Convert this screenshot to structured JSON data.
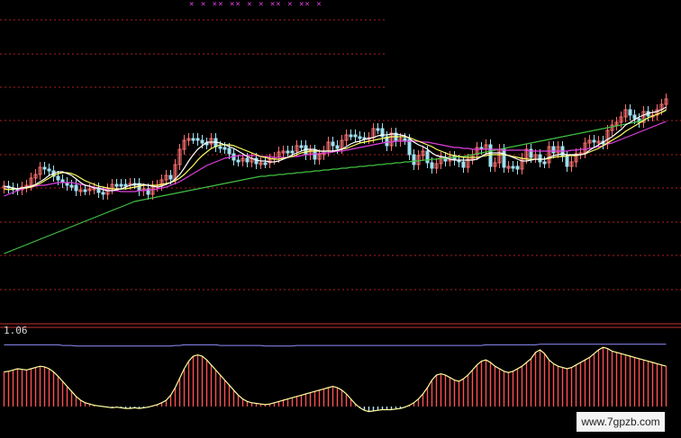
{
  "watermark": "www.7gpzb.com",
  "top_marks": "× ×  ×× ××  × ×  ××  × ××  ×",
  "colors": {
    "background": "#000000",
    "grid": "#b02020",
    "divider": "#c03030",
    "candle_up": "#ff7070",
    "candle_down": "#9fe0f0",
    "ma_short": "#ffffff",
    "ma_mid": "#ffff66",
    "ma_long": "#e040e0",
    "ma_very_long": "#40c040",
    "osc_line": "#ffffa0",
    "osc_bar_pos": "#ff5050",
    "osc_bar_neg": "#b0e0ff",
    "osc_ref_line": "#9090ff"
  },
  "chart_data": [
    {
      "type": "candlestick",
      "panel": "price",
      "grid": true,
      "candles_close": [
        207,
        209,
        210,
        211,
        208,
        206,
        198,
        194,
        186,
        188,
        190,
        196,
        200,
        203,
        206,
        206,
        212,
        211,
        211,
        210,
        209,
        214,
        216,
        210,
        205,
        205,
        205,
        205,
        204,
        204,
        212,
        210,
        216,
        207,
        206,
        200,
        195,
        199,
        183,
        166,
        156,
        154,
        154,
        156,
        159,
        160,
        154,
        163,
        164,
        165,
        171,
        178,
        179,
        176,
        180,
        176,
        182,
        181,
        181,
        177,
        175,
        169,
        168,
        168,
        168,
        162,
        162,
        172,
        167,
        177,
        172,
        168,
        158,
        162,
        165,
        156,
        150,
        150,
        152,
        153,
        154,
        153,
        143,
        143,
        152,
        162,
        148,
        157,
        154,
        155,
        172,
        183,
        173,
        168,
        181,
        187,
        182,
        175,
        179,
        174,
        178,
        180,
        186,
        177,
        172,
        164,
        166,
        161,
        185,
        181,
        166,
        186,
        185,
        185,
        188,
        176,
        166,
        175,
        172,
        180,
        181,
        163,
        170,
        163,
        174,
        185,
        180,
        171,
        170,
        159,
        156,
        158,
        157,
        160,
        145,
        139,
        136,
        130,
        122,
        128,
        132,
        136,
        124,
        129,
        128,
        122,
        116,
        110
      ],
      "ma_short": [
        207,
        208,
        209,
        210,
        209,
        208,
        207,
        205,
        202,
        199,
        195,
        193,
        191,
        191,
        193,
        195,
        199,
        203,
        206,
        207,
        209,
        209,
        211,
        212,
        212,
        211,
        210,
        208,
        206,
        205,
        205,
        205,
        206,
        207,
        208,
        207,
        205,
        203,
        199,
        194,
        187,
        179,
        172,
        166,
        162,
        158,
        158,
        158,
        159,
        161,
        163,
        165,
        168,
        171,
        174,
        176,
        178,
        179,
        179,
        180,
        180,
        179,
        177,
        175,
        172,
        170,
        168,
        166,
        166,
        166,
        168,
        168,
        168,
        168,
        167,
        166,
        163,
        160,
        158,
        157,
        155,
        154,
        153,
        151,
        150,
        150,
        149,
        149,
        150,
        151,
        154,
        158,
        161,
        163,
        166,
        170,
        173,
        174,
        175,
        177,
        178,
        178,
        178,
        178,
        178,
        177,
        174,
        171,
        170,
        170,
        170,
        171,
        173,
        175,
        177,
        179,
        179,
        178,
        177,
        177,
        177,
        175,
        173,
        172,
        171,
        172,
        172,
        172,
        172,
        171,
        167,
        164,
        161,
        158,
        155,
        152,
        148,
        144,
        139,
        136,
        133,
        130,
        128,
        126,
        125,
        124,
        122,
        119
      ],
      "ma_mid": [
        210,
        211,
        210,
        210,
        209,
        209,
        208,
        206,
        204,
        201,
        198,
        195,
        193,
        192,
        192,
        193,
        195,
        198,
        201,
        203,
        205,
        207,
        208,
        209,
        210,
        210,
        210,
        210,
        209,
        208,
        207,
        206,
        206,
        206,
        206,
        205,
        204,
        203,
        201,
        198,
        194,
        189,
        184,
        178,
        173,
        169,
        165,
        163,
        161,
        161,
        161,
        162,
        164,
        166,
        168,
        170,
        172,
        174,
        175,
        176,
        177,
        177,
        176,
        175,
        174,
        172,
        170,
        169,
        168,
        168,
        168,
        168,
        168,
        168,
        167,
        166,
        165,
        163,
        161,
        159,
        158,
        157,
        156,
        155,
        154,
        153,
        152,
        152,
        152,
        152,
        153,
        155,
        157,
        159,
        161,
        163,
        166,
        168,
        170,
        172,
        173,
        174,
        175,
        175,
        175,
        175,
        174,
        173,
        172,
        172,
        172,
        172,
        173,
        174,
        175,
        176,
        177,
        177,
        177,
        177,
        177,
        176,
        175,
        174,
        174,
        173,
        173,
        173,
        172,
        171,
        169,
        167,
        165,
        162,
        159,
        156,
        153,
        150,
        146,
        143,
        140,
        137,
        134,
        131,
        129,
        127,
        125,
        122
      ],
      "ma_long": [
        218,
        216,
        214,
        212,
        210,
        209,
        208,
        207,
        206,
        206,
        205,
        204,
        203,
        203,
        203,
        203,
        204,
        205,
        206,
        207,
        208,
        209,
        210,
        211,
        212,
        212,
        213,
        213,
        213,
        213,
        212,
        212,
        211,
        211,
        210,
        209,
        208,
        206,
        204,
        202,
        199,
        196,
        193,
        190,
        187,
        184,
        182,
        180,
        178,
        176,
        175,
        174,
        173,
        173,
        173,
        173,
        173,
        174,
        174,
        174,
        175,
        175,
        175,
        175,
        174,
        174,
        173,
        172,
        172,
        171,
        171,
        170,
        170,
        169,
        168,
        168,
        167,
        166,
        165,
        164,
        163,
        162,
        161,
        160,
        159,
        158,
        158,
        157,
        157,
        157,
        157,
        157,
        157,
        158,
        158,
        159,
        160,
        161,
        162,
        163,
        164,
        164,
        165,
        165,
        166,
        166,
        166,
        166,
        166,
        166,
        166,
        167,
        167,
        167,
        167,
        167,
        167,
        168,
        168,
        168,
        168,
        168,
        168,
        168,
        168,
        168,
        167,
        167,
        166,
        166,
        165,
        164,
        163,
        162,
        160,
        159,
        157,
        155,
        153,
        151,
        149,
        147,
        145,
        143,
        141,
        139,
        137,
        135
      ],
      "ma_very_long": [
        282,
        280,
        278,
        276,
        274,
        272,
        270,
        268,
        266,
        264,
        262,
        260,
        258,
        256,
        254,
        252,
        250,
        248,
        246,
        244,
        242,
        240,
        238,
        236,
        234,
        232,
        230,
        228,
        226,
        224,
        223,
        222,
        221,
        220,
        219,
        218,
        217,
        216,
        215,
        214,
        213,
        212,
        211,
        210,
        209,
        208,
        207,
        206,
        205,
        204,
        203,
        202,
        201,
        200,
        199,
        198,
        197,
        196,
        196,
        195,
        195,
        194,
        194,
        193,
        193,
        192,
        192,
        191,
        191,
        190,
        190,
        189,
        189,
        188,
        188,
        187,
        187,
        186,
        186,
        185,
        185,
        184,
        184,
        183,
        183,
        182,
        182,
        181,
        181,
        180,
        180,
        179,
        179,
        178,
        178,
        177,
        177,
        176,
        176,
        175,
        175,
        174,
        174,
        173,
        172,
        171,
        170,
        169,
        168,
        167,
        166,
        165,
        164,
        163,
        162,
        161,
        160,
        159,
        158,
        157,
        156,
        155,
        154,
        153,
        152,
        151,
        150,
        149,
        148,
        147,
        146,
        145,
        144,
        143,
        142,
        141,
        140,
        139,
        138,
        137,
        136,
        135,
        133,
        131,
        129,
        127,
        125,
        123
      ]
    },
    {
      "type": "bar",
      "panel": "oscillator",
      "label": "1.06",
      "grid": false,
      "values": [
        0.55,
        0.56,
        0.58,
        0.6,
        0.59,
        0.58,
        0.6,
        0.62,
        0.64,
        0.63,
        0.6,
        0.55,
        0.48,
        0.4,
        0.32,
        0.24,
        0.16,
        0.1,
        0.06,
        0.04,
        0.02,
        0.01,
        0.0,
        -0.01,
        -0.02,
        -0.01,
        -0.02,
        -0.03,
        -0.03,
        -0.02,
        -0.03,
        -0.02,
        -0.01,
        0.01,
        0.03,
        0.06,
        0.1,
        0.18,
        0.3,
        0.45,
        0.6,
        0.72,
        0.8,
        0.82,
        0.8,
        0.74,
        0.66,
        0.58,
        0.5,
        0.42,
        0.34,
        0.26,
        0.18,
        0.12,
        0.08,
        0.06,
        0.05,
        0.04,
        0.03,
        0.04,
        0.06,
        0.08,
        0.1,
        0.12,
        0.14,
        0.16,
        0.18,
        0.2,
        0.22,
        0.24,
        0.26,
        0.28,
        0.3,
        0.32,
        0.3,
        0.26,
        0.2,
        0.12,
        0.04,
        -0.02,
        -0.06,
        -0.08,
        -0.07,
        -0.06,
        -0.05,
        -0.05,
        -0.05,
        -0.04,
        -0.03,
        -0.01,
        0.02,
        0.06,
        0.12,
        0.2,
        0.3,
        0.42,
        0.5,
        0.52,
        0.5,
        0.46,
        0.42,
        0.4,
        0.44,
        0.5,
        0.58,
        0.66,
        0.72,
        0.74,
        0.7,
        0.64,
        0.6,
        0.56,
        0.54,
        0.56,
        0.6,
        0.64,
        0.7,
        0.76,
        0.86,
        0.9,
        0.84,
        0.74,
        0.68,
        0.64,
        0.62,
        0.6,
        0.62,
        0.66,
        0.7,
        0.74,
        0.78,
        0.84,
        0.9,
        0.94,
        0.92,
        0.88,
        0.86,
        0.84,
        0.82,
        0.8,
        0.78,
        0.76,
        0.74,
        0.72,
        0.7,
        0.68,
        0.66,
        0.64
      ],
      "ref_line": [
        0.98,
        0.98,
        0.98,
        0.98,
        0.98,
        0.98,
        0.98,
        0.98,
        0.98,
        0.98,
        0.98,
        0.98,
        0.98,
        0.97,
        0.97,
        0.97,
        0.96,
        0.96,
        0.96,
        0.96,
        0.96,
        0.96,
        0.96,
        0.96,
        0.96,
        0.96,
        0.96,
        0.96,
        0.96,
        0.96,
        0.96,
        0.96,
        0.96,
        0.96,
        0.96,
        0.96,
        0.96,
        0.96,
        0.97,
        0.97,
        0.98,
        0.98,
        0.98,
        0.98,
        0.98,
        0.98,
        0.98,
        0.98,
        0.97,
        0.97,
        0.97,
        0.97,
        0.97,
        0.97,
        0.97,
        0.97,
        0.97,
        0.97,
        0.96,
        0.96,
        0.96,
        0.96,
        0.96,
        0.96,
        0.96,
        0.97,
        0.97,
        0.97,
        0.97,
        0.97,
        0.97,
        0.97,
        0.97,
        0.97,
        0.97,
        0.97,
        0.97,
        0.97,
        0.97,
        0.97,
        0.97,
        0.97,
        0.97,
        0.97,
        0.97,
        0.97,
        0.97,
        0.97,
        0.97,
        0.97,
        0.97,
        0.97,
        0.97,
        0.97,
        0.97,
        0.97,
        0.97,
        0.97,
        0.97,
        0.97,
        0.97,
        0.97,
        0.97,
        0.97,
        0.97,
        0.97,
        0.97,
        0.98,
        0.98,
        0.98,
        0.98,
        0.98,
        0.98,
        0.98,
        0.98,
        0.98,
        0.98,
        0.98,
        0.98,
        0.99,
        0.99,
        0.99,
        0.99,
        0.99,
        0.99,
        0.99,
        0.99,
        0.99,
        0.99,
        0.99,
        0.99,
        0.99,
        0.99,
        0.99,
        0.99,
        0.99,
        0.99,
        0.99,
        0.99,
        0.99,
        0.99,
        0.99,
        0.99,
        0.99,
        0.99,
        0.99,
        0.99,
        0.99
      ]
    }
  ]
}
